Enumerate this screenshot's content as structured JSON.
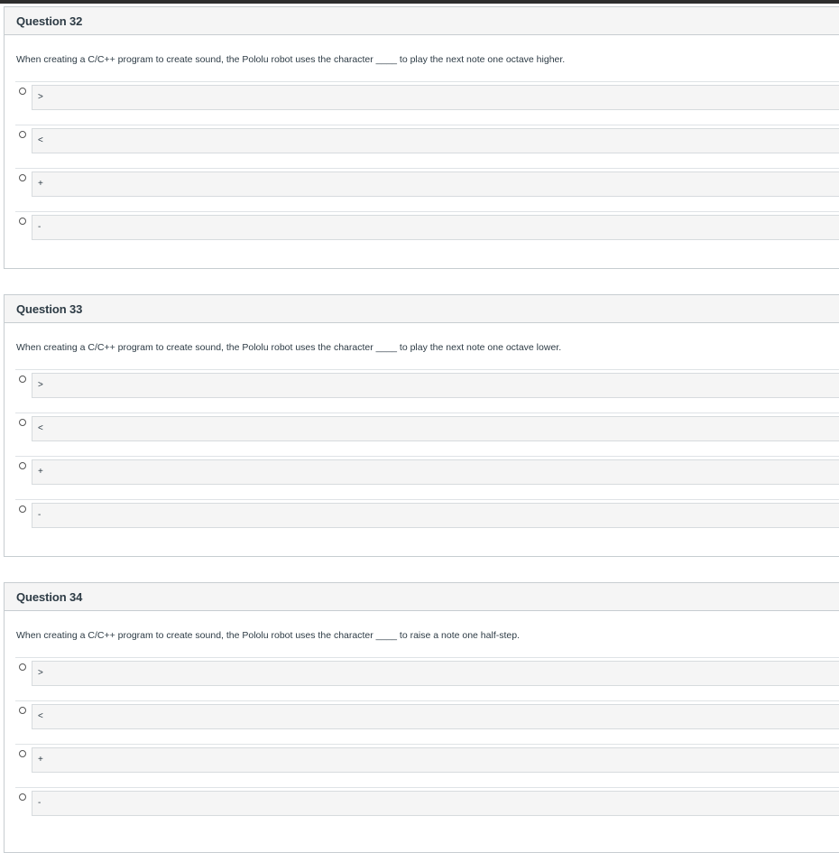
{
  "questions": [
    {
      "title": "Question 32",
      "text": "When creating a C/C++ program to create sound, the Pololu robot uses the character ____ to play the next note one octave higher.",
      "answers": [
        ">",
        "<",
        "+",
        "-"
      ]
    },
    {
      "title": "Question 33",
      "text": "When creating a C/C++ program to create sound, the Pololu robot uses the character ____ to play the next note one octave lower.",
      "answers": [
        ">",
        "<",
        "+",
        "-"
      ]
    },
    {
      "title": "Question 34",
      "text": "When creating a C/C++ program to create sound, the Pololu robot uses the character ____ to raise a note one half-step.",
      "answers": [
        ">",
        "<",
        "+",
        "-"
      ]
    }
  ]
}
